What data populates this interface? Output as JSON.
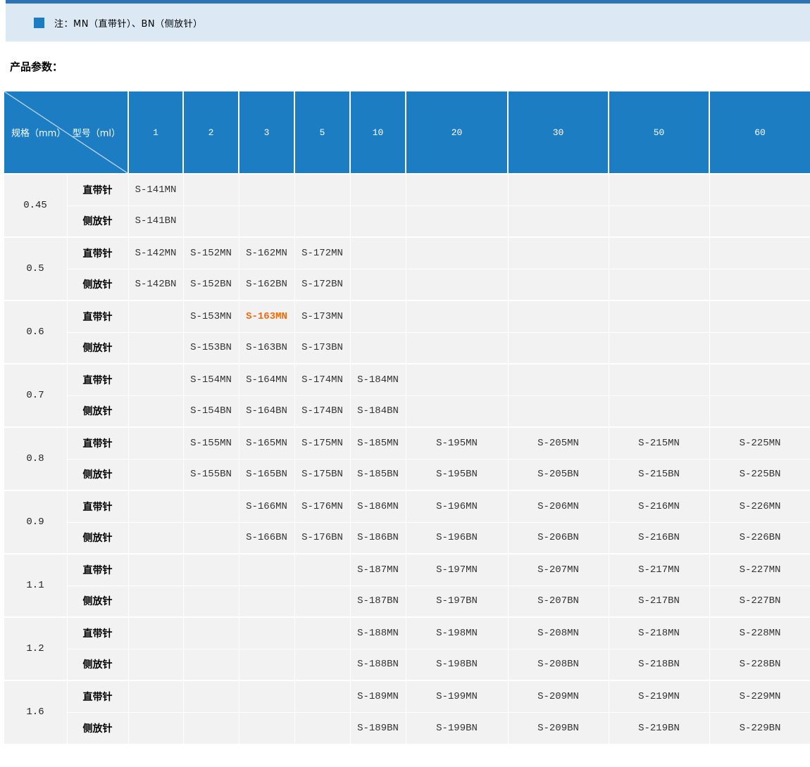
{
  "colors": {
    "top_strip": "#2e73b8",
    "note_bar_bg": "#dce9f5",
    "header_blue": "#1d7dc3",
    "row_bg": "#f2f2f2",
    "highlight_orange": "#ef6a0e"
  },
  "note": {
    "text": "注：MN（直带针）、BN（侧放针）"
  },
  "section_title": "产品参数：",
  "table": {
    "corner": {
      "row_label": "规格（mm）",
      "col_label": "型号（ml）"
    },
    "volume_headers": [
      "1",
      "2",
      "3",
      "5",
      "10",
      "20",
      "30",
      "50",
      "60"
    ],
    "row_type_labels": [
      "直带针",
      "侧放针"
    ],
    "highlight_cell": {
      "group": 2,
      "row": "mn",
      "col": 2
    },
    "groups": [
      {
        "spec": "0.45",
        "mn": [
          "S-141MN",
          "",
          "",
          "",
          "",
          "",
          "",
          "",
          ""
        ],
        "bn": [
          "S-141BN",
          "",
          "",
          "",
          "",
          "",
          "",
          "",
          ""
        ]
      },
      {
        "spec": "0.5",
        "mn": [
          "S-142MN",
          "S-152MN",
          "S-162MN",
          "S-172MN",
          "",
          "",
          "",
          "",
          ""
        ],
        "bn": [
          "S-142BN",
          "S-152BN",
          "S-162BN",
          "S-172BN",
          "",
          "",
          "",
          "",
          ""
        ]
      },
      {
        "spec": "0.6",
        "mn": [
          "",
          "S-153MN",
          "S-163MN",
          "S-173MN",
          "",
          "",
          "",
          "",
          ""
        ],
        "bn": [
          "",
          "S-153BN",
          "S-163BN",
          "S-173BN",
          "",
          "",
          "",
          "",
          ""
        ]
      },
      {
        "spec": "0.7",
        "mn": [
          "",
          "S-154MN",
          "S-164MN",
          "S-174MN",
          "S-184MN",
          "",
          "",
          "",
          ""
        ],
        "bn": [
          "",
          "S-154BN",
          "S-164BN",
          "S-174BN",
          "S-184BN",
          "",
          "",
          "",
          ""
        ]
      },
      {
        "spec": "0.8",
        "mn": [
          "",
          "S-155MN",
          "S-165MN",
          "S-175MN",
          "S-185MN",
          "S-195MN",
          "S-205MN",
          "S-215MN",
          "S-225MN"
        ],
        "bn": [
          "",
          "S-155BN",
          "S-165BN",
          "S-175BN",
          "S-185BN",
          "S-195BN",
          "S-205BN",
          "S-215BN",
          "S-225BN"
        ]
      },
      {
        "spec": "0.9",
        "mn": [
          "",
          "",
          "S-166MN",
          "S-176MN",
          "S-186MN",
          "S-196MN",
          "S-206MN",
          "S-216MN",
          "S-226MN"
        ],
        "bn": [
          "",
          "",
          "S-166BN",
          "S-176BN",
          "S-186BN",
          "S-196BN",
          "S-206BN",
          "S-216BN",
          "S-226BN"
        ]
      },
      {
        "spec": "1.1",
        "mn": [
          "",
          "",
          "",
          "",
          "S-187MN",
          "S-197MN",
          "S-207MN",
          "S-217MN",
          "S-227MN"
        ],
        "bn": [
          "",
          "",
          "",
          "",
          "S-187BN",
          "S-197BN",
          "S-207BN",
          "S-217BN",
          "S-227BN"
        ]
      },
      {
        "spec": "1.2",
        "mn": [
          "",
          "",
          "",
          "",
          "S-188MN",
          "S-198MN",
          "S-208MN",
          "S-218MN",
          "S-228MN"
        ],
        "bn": [
          "",
          "",
          "",
          "",
          "S-188BN",
          "S-198BN",
          "S-208BN",
          "S-218BN",
          "S-228BN"
        ]
      },
      {
        "spec": "1.6",
        "mn": [
          "",
          "",
          "",
          "",
          "S-189MN",
          "S-199MN",
          "S-209MN",
          "S-219MN",
          "S-229MN"
        ],
        "bn": [
          "",
          "",
          "",
          "",
          "S-189BN",
          "S-199BN",
          "S-209BN",
          "S-219BN",
          "S-229BN"
        ]
      }
    ]
  }
}
